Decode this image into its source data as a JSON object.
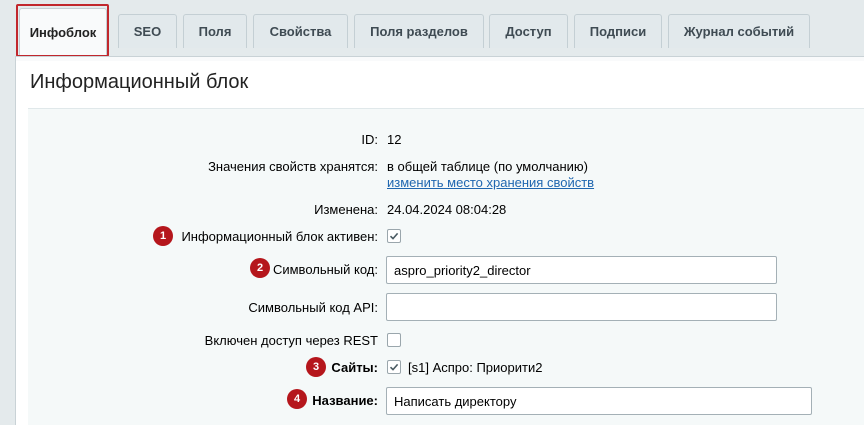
{
  "tabs": [
    {
      "label": "Инфоблок",
      "active": true
    },
    {
      "label": "SEO"
    },
    {
      "label": "Поля"
    },
    {
      "label": "Свойства"
    },
    {
      "label": "Поля разделов"
    },
    {
      "label": "Доступ"
    },
    {
      "label": "Подписи"
    },
    {
      "label": "Журнал событий"
    }
  ],
  "panel": {
    "title": "Информационный блок"
  },
  "form": {
    "id": {
      "label": "ID:",
      "value": "12"
    },
    "storage": {
      "label": "Значения свойств хранятся:",
      "value": "в общей таблице (по умолчанию)",
      "link": "изменить место хранения свойств"
    },
    "modified": {
      "label": "Изменена:",
      "value": "24.04.2024 08:04:28"
    },
    "active": {
      "label": "Информационный блок активен:",
      "checked": true,
      "badge": "1"
    },
    "code": {
      "label": "Символьный код:",
      "value": "aspro_priority2_director",
      "badge": "2"
    },
    "api_code": {
      "label": "Символьный код API:",
      "value": ""
    },
    "rest": {
      "label": "Включен доступ через REST",
      "checked": false
    },
    "sites": {
      "label": "Сайты:",
      "option": "[s1] Аспро: Приорити2",
      "checked": true,
      "badge": "3"
    },
    "name": {
      "label": "Название:",
      "value": "Написать директору",
      "badge": "4"
    }
  },
  "colors": {
    "accent": "#2067b0",
    "badge": "#b5161c",
    "highlight": "#c1272d"
  }
}
